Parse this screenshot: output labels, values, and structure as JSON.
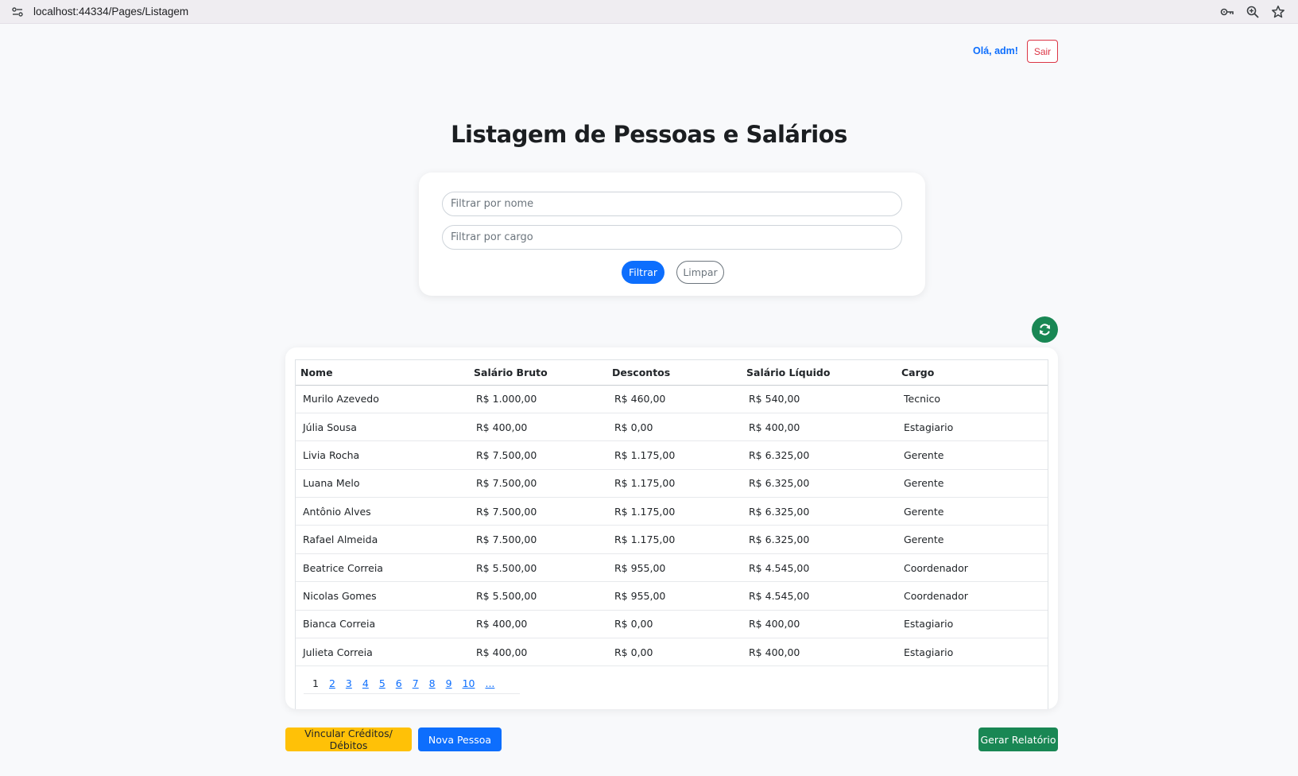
{
  "browser": {
    "url": "localhost:44334/Pages/Listagem"
  },
  "header": {
    "greeting": "Olá, adm!",
    "logout_label": "Sair"
  },
  "page": {
    "title": "Listagem de Pessoas e Salários"
  },
  "filters": {
    "name_placeholder": "Filtrar por nome",
    "role_placeholder": "Filtrar por cargo",
    "filter_label": "Filtrar",
    "clear_label": "Limpar"
  },
  "table": {
    "columns": [
      "Nome",
      "Salário Bruto",
      "Descontos",
      "Salário Líquido",
      "Cargo"
    ],
    "rows": [
      [
        "Murilo Azevedo",
        "R$ 1.000,00",
        "R$ 460,00",
        "R$ 540,00",
        "Tecnico"
      ],
      [
        "Júlia Sousa",
        "R$ 400,00",
        "R$ 0,00",
        "R$ 400,00",
        "Estagiario"
      ],
      [
        "Livia Rocha",
        "R$ 7.500,00",
        "R$ 1.175,00",
        "R$ 6.325,00",
        "Gerente"
      ],
      [
        "Luana Melo",
        "R$ 7.500,00",
        "R$ 1.175,00",
        "R$ 6.325,00",
        "Gerente"
      ],
      [
        "Antônio Alves",
        "R$ 7.500,00",
        "R$ 1.175,00",
        "R$ 6.325,00",
        "Gerente"
      ],
      [
        "Rafael Almeida",
        "R$ 7.500,00",
        "R$ 1.175,00",
        "R$ 6.325,00",
        "Gerente"
      ],
      [
        "Beatrice Correia",
        "R$ 5.500,00",
        "R$ 955,00",
        "R$ 4.545,00",
        "Coordenador"
      ],
      [
        "Nicolas Gomes",
        "R$ 5.500,00",
        "R$ 955,00",
        "R$ 4.545,00",
        "Coordenador"
      ],
      [
        "Bianca Correia",
        "R$ 400,00",
        "R$ 0,00",
        "R$ 400,00",
        "Estagiario"
      ],
      [
        "Julieta Correia",
        "R$ 400,00",
        "R$ 0,00",
        "R$ 400,00",
        "Estagiario"
      ]
    ]
  },
  "pagination": {
    "current": "1",
    "pages": [
      "2",
      "3",
      "4",
      "5",
      "6",
      "7",
      "8",
      "9",
      "10",
      "..."
    ]
  },
  "actions": {
    "link_label": "Vincular Créditos/ Débitos",
    "new_person_label": "Nova Pessoa",
    "report_label": "Gerar Relatório"
  },
  "colors": {
    "primary": "#0d6efd",
    "danger": "#dc3545",
    "success": "#198754",
    "warning": "#ffc107"
  },
  "icons": {
    "site_info": "site-settings-icon",
    "key": "key-icon",
    "zoom": "zoom-icon",
    "bookmark": "star-icon",
    "refresh": "refresh-icon"
  }
}
